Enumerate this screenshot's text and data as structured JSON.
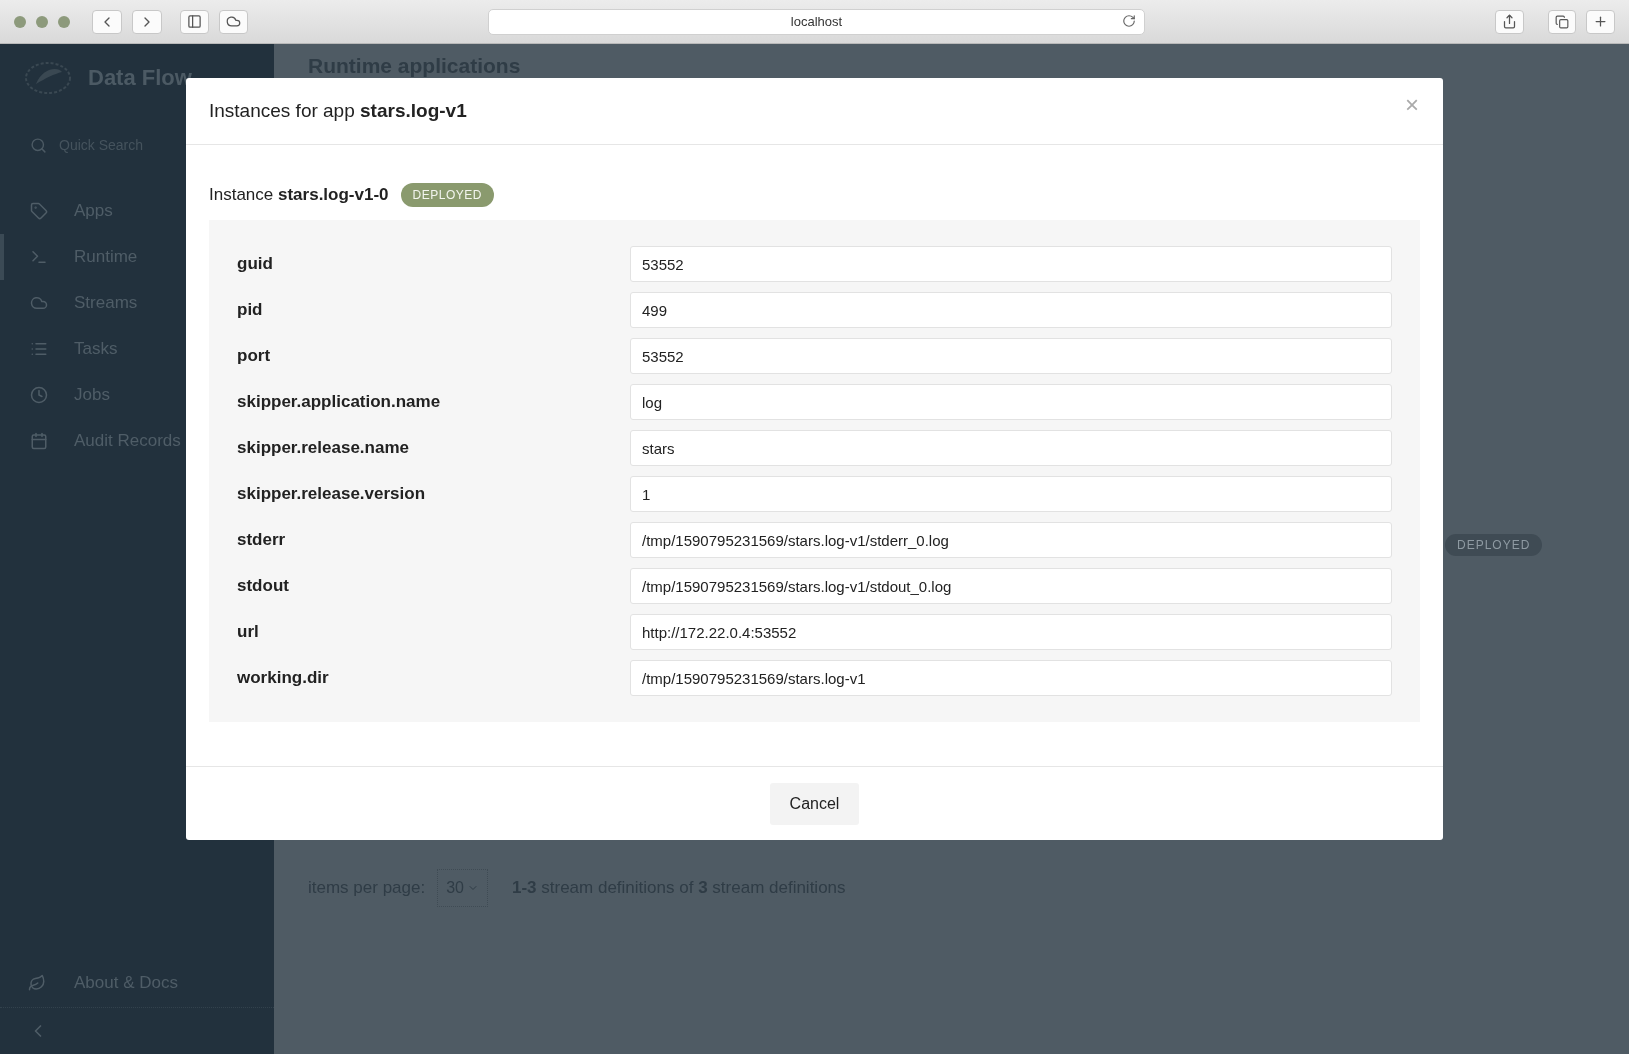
{
  "browser": {
    "url": "localhost"
  },
  "sidebar": {
    "brand": "Data Flow",
    "search_placeholder": "Quick Search",
    "items": [
      {
        "label": "Apps",
        "selected": false
      },
      {
        "label": "Runtime",
        "selected": true
      },
      {
        "label": "Streams",
        "selected": false
      },
      {
        "label": "Tasks",
        "selected": false
      },
      {
        "label": "Jobs",
        "selected": false
      },
      {
        "label": "Audit Records",
        "selected": false
      }
    ],
    "footer_item": "About & Docs"
  },
  "page": {
    "title": "Runtime applications",
    "status_badge": "DEPLOYED",
    "pagination": {
      "label": "items per page:",
      "page_size": "30",
      "summary": "**1-3** stream definitions of **3** stream definitions"
    }
  },
  "modal": {
    "title": "Instances for app **stars.log-v1**",
    "close": "×",
    "instance": {
      "label": "Instance **stars.log-v1-0**",
      "status": "DEPLOYED"
    },
    "properties": [
      {
        "name": "guid",
        "value": "53552"
      },
      {
        "name": "pid",
        "value": "499"
      },
      {
        "name": "port",
        "value": "53552"
      },
      {
        "name": "skipper.application.name",
        "value": "log"
      },
      {
        "name": "skipper.release.name",
        "value": "stars"
      },
      {
        "name": "skipper.release.version",
        "value": "1"
      },
      {
        "name": "stderr",
        "value": "/tmp/1590795231569/stars.log-v1/stderr_0.log"
      },
      {
        "name": "stdout",
        "value": "/tmp/1590795231569/stars.log-v1/stdout_0.log"
      },
      {
        "name": "url",
        "value": "http://172.22.0.4:53552"
      },
      {
        "name": "working.dir",
        "value": "/tmp/1590795231569/stars.log-v1"
      }
    ],
    "buttons": [
      "Cancel"
    ]
  }
}
